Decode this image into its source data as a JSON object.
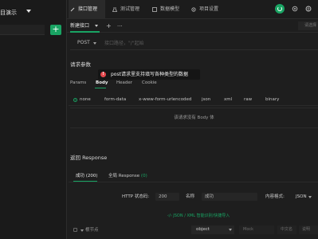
{
  "sidebar": {
    "project_title": "目演示",
    "add_label": "+"
  },
  "topbar": {
    "tabs": [
      {
        "label": "接口管理",
        "active": true
      },
      {
        "label": "测试管理",
        "active": false
      },
      {
        "label": "数据模型",
        "active": false
      },
      {
        "label": "项目设置",
        "active": false
      }
    ]
  },
  "subtabs": {
    "new_tab_label": "新建接口",
    "plus": "+",
    "more": "···",
    "env_placeholder": "请选择"
  },
  "request": {
    "method": "POST",
    "url_placeholder": "接口路径，\"/\"起始",
    "section_title": "请求参数",
    "tooltip": "post请求里支持填写各种类型的数据",
    "param_tabs": [
      "Params",
      "Body",
      "Header",
      "Cookie"
    ],
    "active_param_tab": "Body",
    "body_types": [
      "none",
      "form-data",
      "x-www-form-urlencoded",
      "json",
      "xml",
      "raw",
      "binary"
    ],
    "selected_body_type": "none",
    "empty_body_text": "该请求没有 Body 体"
  },
  "response": {
    "section_title": "返回 Response",
    "tabs": [
      {
        "label": "成功 (200)",
        "active": true
      },
      {
        "label": "全局 Response",
        "count": "(0)",
        "active": false
      }
    ],
    "status_label": "HTTP 状态码:",
    "status_value": "200",
    "name_label": "名称",
    "name_value": "成功",
    "format_label": "内容格式:",
    "format_value": "JSON",
    "import_link": "JSON / XML 智能识别/快捷导入",
    "root_label": "根节点",
    "type_value": "object",
    "mock_placeholder": "Mock",
    "cn_name_placeholder": "中文名",
    "desc_placeholder": "说明"
  }
}
